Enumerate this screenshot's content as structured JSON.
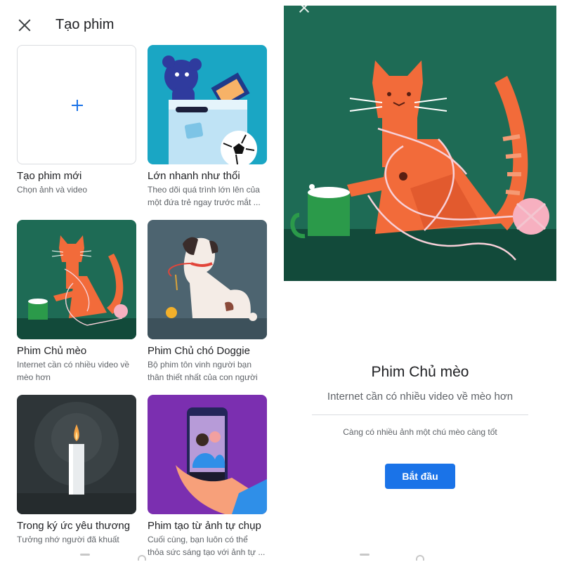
{
  "left": {
    "title": "Tạo phim",
    "cards": [
      {
        "name": "Tạo phim mới",
        "desc1": "Chọn ảnh và video",
        "desc2": ""
      },
      {
        "name": "Lớn nhanh như thổi",
        "desc1": "Theo dõi quá trình lớn lên của",
        "desc2": "một đứa trẻ ngay trước mắt ..."
      },
      {
        "name": "Phim Chủ mèo",
        "desc1": "Internet cần có nhiều video về",
        "desc2": "mèo hơn"
      },
      {
        "name": "Phim Chủ chó Doggie",
        "desc1": "Bộ phim tôn vinh người bạn",
        "desc2": "thân thiết nhất của con người"
      },
      {
        "name": "Trong ký ức yêu thương",
        "desc1": "Tưởng nhớ người đã khuất",
        "desc2": ""
      },
      {
        "name": "Phim tạo từ ảnh tự chụp",
        "desc1": "Cuối cùng, bạn luôn có thể",
        "desc2": "thỏa sức sáng tạo với ảnh tự ..."
      }
    ]
  },
  "right": {
    "title": "Phim Chủ mèo",
    "subtitle": "Internet cần có nhiều video về mèo hơn",
    "note": "Càng có nhiều ảnh một chú mèo càng tốt",
    "start_label": "Bắt đầu"
  },
  "colors": {
    "accent": "#1a73e8",
    "cat_bg": "#1e6b55",
    "cat": "#f26b3a"
  }
}
